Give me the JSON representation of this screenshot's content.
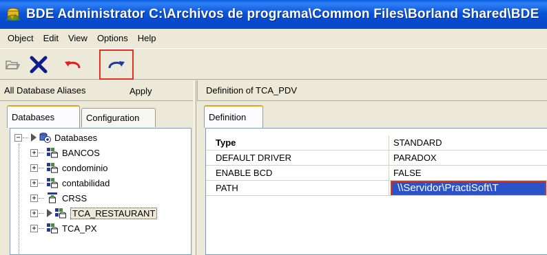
{
  "window": {
    "title": "BDE Administrator  C:\\Archivos de programa\\Common Files\\Borland Shared\\BDE",
    "icon": "bde-app-icon"
  },
  "menubar": {
    "items": [
      "Object",
      "Edit",
      "View",
      "Options",
      "Help"
    ]
  },
  "toolbar": {
    "buttons": [
      {
        "name": "open-icon"
      },
      {
        "name": "delete-icon"
      },
      {
        "name": "undo-icon"
      },
      {
        "name": "apply-icon",
        "highlighted": true
      }
    ],
    "tooltip": "Apply"
  },
  "left_header": {
    "label": "All Database Aliases"
  },
  "right_header": {
    "label": "Definition of TCA_PDV"
  },
  "left_tabs": [
    {
      "label": "Databases",
      "active": true
    },
    {
      "label": "Configuration",
      "active": false
    }
  ],
  "right_tabs": [
    {
      "label": "Definition",
      "active": true
    }
  ],
  "tree": {
    "root": {
      "label": "Databases",
      "icon": "databases-icon",
      "expanded": true
    },
    "items": [
      {
        "label": "BANCOS",
        "icon": "database-alias-icon"
      },
      {
        "label": "condominio",
        "icon": "database-alias-icon"
      },
      {
        "label": "contabilidad",
        "icon": "database-alias-icon"
      },
      {
        "label": "CRSS",
        "icon": "database-odbc-icon"
      },
      {
        "label": "TCA_RESTAURANT",
        "icon": "database-alias-icon",
        "open": true
      },
      {
        "label": "TCA_PX",
        "icon": "database-alias-icon"
      }
    ]
  },
  "definition": {
    "rows": [
      {
        "key": "Type",
        "value": "STANDARD",
        "bold": true
      },
      {
        "key": "DEFAULT DRIVER",
        "value": "PARADOX"
      },
      {
        "key": "ENABLE BCD",
        "value": "FALSE"
      },
      {
        "key": "PATH",
        "value": "\\\\Servidor\\PractiSoft\\T",
        "editing": true
      }
    ]
  },
  "colors": {
    "title_bar": "#0a55d8",
    "highlight_border": "#e03020",
    "edit_selection": "#2b53c9",
    "window_bg": "#ece9d8"
  }
}
